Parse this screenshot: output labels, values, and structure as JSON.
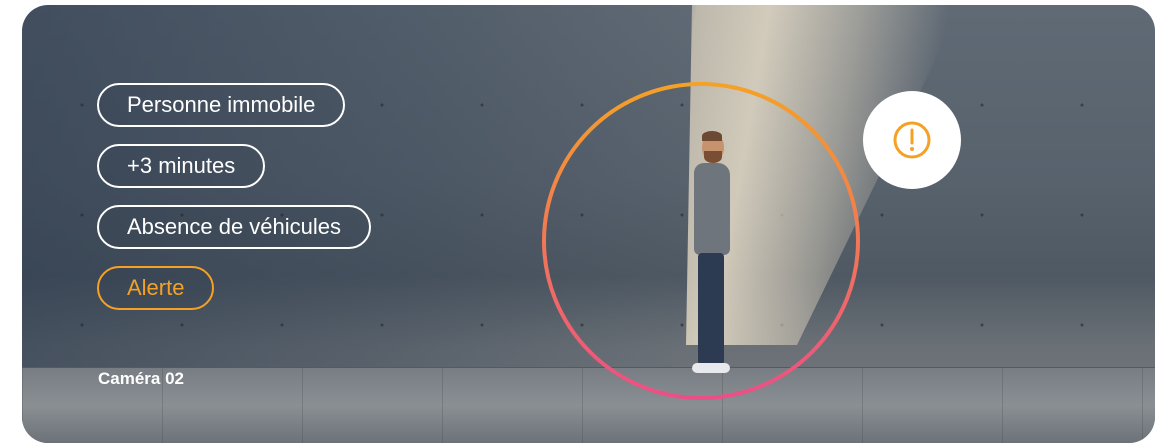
{
  "camera": {
    "label": "Caméra 02"
  },
  "tags": [
    {
      "label": "Personne immobile",
      "type": "info"
    },
    {
      "label": "+3 minutes",
      "type": "info"
    },
    {
      "label": "Absence de véhicules",
      "type": "info"
    },
    {
      "label": "Alerte",
      "type": "alert"
    }
  ],
  "colors": {
    "alert": "#f5a126",
    "ring_gradient_start": "#f5a126",
    "ring_gradient_end": "#ec4f86",
    "tag_border": "#ffffff"
  },
  "icons": {
    "alert_badge": "exclamation-circle-icon"
  }
}
